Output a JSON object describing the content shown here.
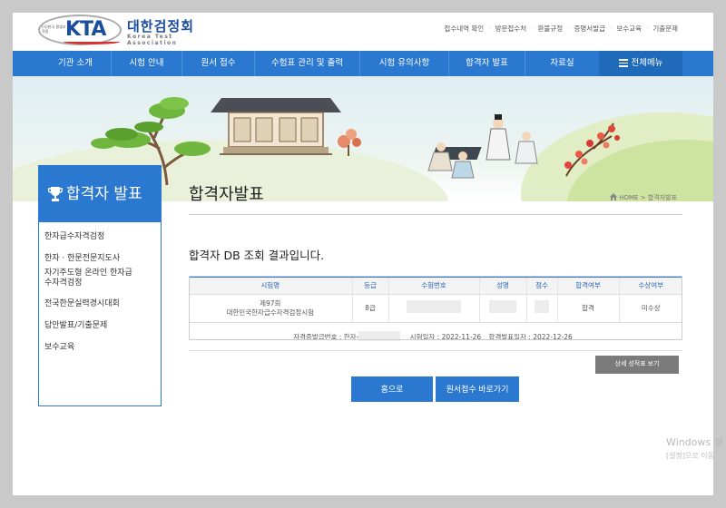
{
  "logo": {
    "kta": "KTA",
    "name": "대한검정회",
    "eng": "Korea Test Association",
    "small": "(사)한국 평생교육원"
  },
  "util_links": [
    "접수내역 확인",
    "방문접수처",
    "환불규정",
    "증명서발급",
    "보수교육",
    "기출문제"
  ],
  "nav": {
    "items": [
      "기관 소개",
      "시험 안내",
      "원서 접수",
      "수험표 관리 및 출력",
      "시험 유의사항",
      "합격자 발표",
      "자료실"
    ],
    "all_menu": "전체메뉴"
  },
  "sidebar": {
    "title": "합격자 발표",
    "items": [
      "한자급수자격검정",
      "한자 · 한문전문지도사",
      "자기주도형 온라인 한자급수자격검정",
      "전국한문실력경시대회",
      "답안발표/기출문제",
      "보수교육"
    ]
  },
  "page": {
    "title": "합격자발표",
    "breadcrumb_home": "HOME",
    "breadcrumb_sep": ">",
    "breadcrumb_current": "합격자발표",
    "result_title": "합격자 DB 조회 결과입니다."
  },
  "table": {
    "headers": [
      "시험명",
      "등급",
      "수험번호",
      "성명",
      "점수",
      "합격여부",
      "수상여부"
    ],
    "row": {
      "exam_line1": "제97회",
      "exam_line2": "대한민국한자급수자격검정시험",
      "grade": "8급",
      "pass": "합격",
      "award": "미수상"
    },
    "footer": {
      "cert_label": "자격증발급번호 : 한자-",
      "date_label": "시험일자 : 2022-11-26",
      "announce_label": "합격발표일자 : 2022-12-26"
    }
  },
  "buttons": {
    "detail": "상세 성적표 보기",
    "home": "홈으로",
    "apply": "원서접수 바로가기"
  },
  "watermark": {
    "line1": "Windows 정",
    "line2": "[설정]으로 이동"
  },
  "colors": {
    "primary": "#2a78cf",
    "button_gray": "#7a7a7a"
  }
}
